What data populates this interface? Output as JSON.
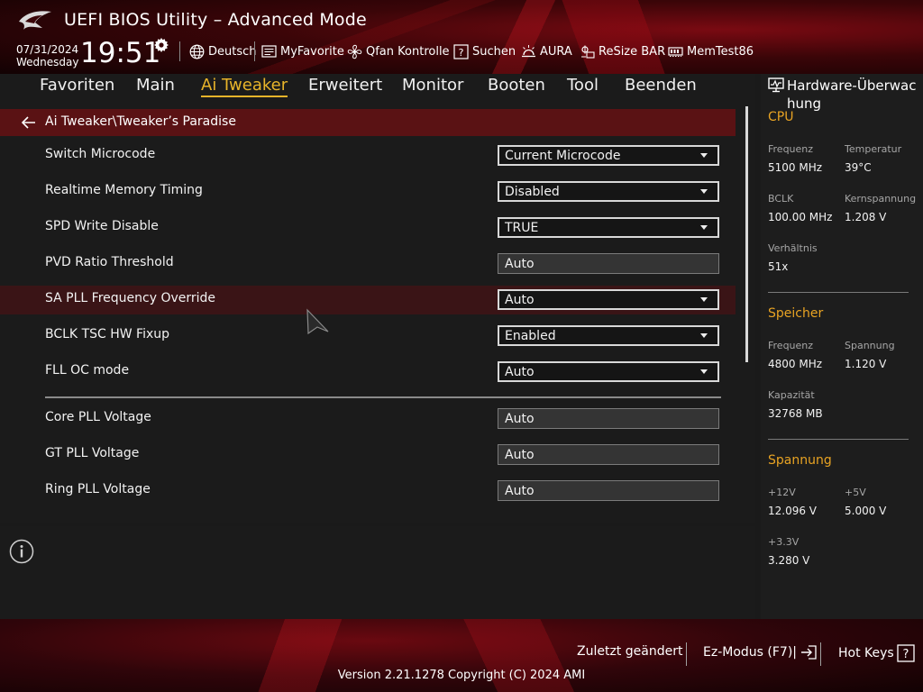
{
  "header": {
    "title": "UEFI BIOS Utility – Advanced Mode",
    "date": "07/31/2024",
    "weekday": "Wednesday",
    "time": "19:51",
    "toolbar": [
      {
        "label": "Deutsch",
        "icon": "globe-icon"
      },
      {
        "label": "MyFavorite",
        "icon": "favorite-icon"
      },
      {
        "label": "Qfan Kontrolle",
        "icon": "fan-icon"
      },
      {
        "label": "Suchen",
        "icon": "help-search-icon"
      },
      {
        "label": "AURA",
        "icon": "aura-icon"
      },
      {
        "label": "ReSize BAR",
        "icon": "resize-bar-icon"
      },
      {
        "label": "MemTest86",
        "icon": "memory-icon"
      }
    ]
  },
  "tabs": [
    {
      "label": "Favoriten"
    },
    {
      "label": "Main"
    },
    {
      "label": "Ai Tweaker",
      "active": true
    },
    {
      "label": "Erweitert"
    },
    {
      "label": "Monitor"
    },
    {
      "label": "Booten"
    },
    {
      "label": "Tool"
    },
    {
      "label": "Beenden"
    }
  ],
  "breadcrumb": "Ai Tweaker\\Tweaker’s Paradise",
  "settings": [
    {
      "label": "Switch Microcode",
      "value": "Current Microcode",
      "type": "select"
    },
    {
      "label": "Realtime Memory Timing",
      "value": "Disabled",
      "type": "select"
    },
    {
      "label": "SPD Write Disable",
      "value": "TRUE",
      "type": "select"
    },
    {
      "label": "PVD Ratio Threshold",
      "value": "Auto",
      "type": "text"
    },
    {
      "label": "SA PLL Frequency Override",
      "value": "Auto",
      "type": "select",
      "highlighted": true
    },
    {
      "label": "BCLK TSC HW Fixup",
      "value": "Enabled",
      "type": "select"
    },
    {
      "label": "FLL OC mode",
      "value": "Auto",
      "type": "select"
    },
    {
      "label": "Core PLL Voltage",
      "value": "Auto",
      "type": "text"
    },
    {
      "label": "GT PLL Voltage",
      "value": "Auto",
      "type": "text"
    },
    {
      "label": "Ring PLL Voltage",
      "value": "Auto",
      "type": "text"
    }
  ],
  "hardware_monitor": {
    "title": "Hardware-Überwac hung",
    "cpu": {
      "heading": "CPU",
      "freq_label": "Frequenz",
      "freq_value": "5100 MHz",
      "temp_label": "Temperatur",
      "temp_value": "39°C",
      "bclk_label": "BCLK",
      "bclk_value": "100.00 MHz",
      "vcore_label": "Kernspannung",
      "vcore_value": "1.208 V",
      "ratio_label": "Verhältnis",
      "ratio_value": "51x"
    },
    "memory": {
      "heading": "Speicher",
      "freq_label": "Frequenz",
      "freq_value": "4800 MHz",
      "volt_label": "Spannung",
      "volt_value": "1.120 V",
      "cap_label": "Kapazität",
      "cap_value": "32768 MB"
    },
    "voltage": {
      "heading": "Spannung",
      "v12_label": "+12V",
      "v12_value": "12.096 V",
      "v5_label": "+5V",
      "v5_value": "5.000 V",
      "v33_label": "+3.3V",
      "v33_value": "3.280 V"
    }
  },
  "footer": {
    "last_changed": "Zuletzt geändert",
    "ez_mode": "Ez-Modus (F7)|",
    "hot_keys": "Hot Keys",
    "version": "Version 2.21.1278 Copyright (C) 2024 AMI"
  },
  "colors": {
    "accent": "#e8b42a",
    "section_heading": "#e8a323",
    "breadcrumb_bg": "#5a1214"
  }
}
